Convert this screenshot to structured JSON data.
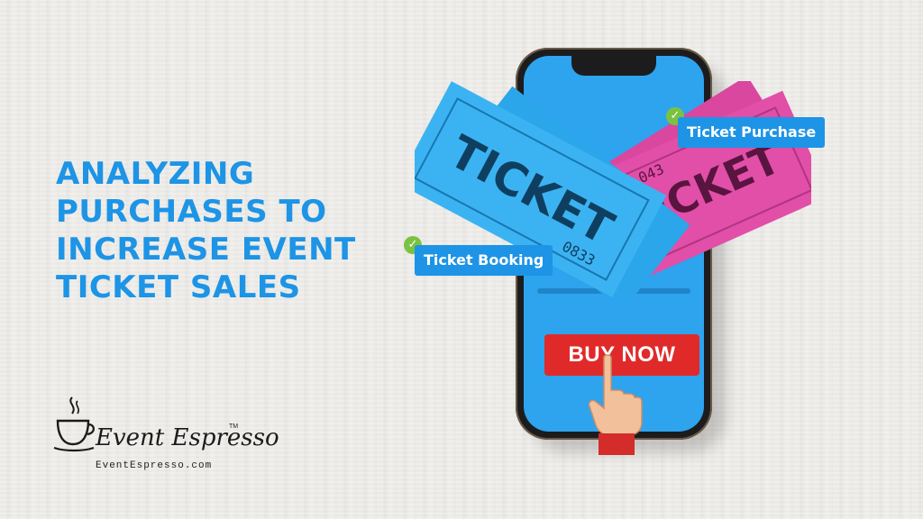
{
  "headline": {
    "line1": "ANALYZING",
    "line2": "PURCHASES TO",
    "line3": "INCREASE EVENT",
    "line4": "TICKET SALES"
  },
  "labels": {
    "booking": "Ticket Booking",
    "purchase": "Ticket Purchase"
  },
  "tickets": {
    "word": "TICKET",
    "number_blue": "0833",
    "number_pink": "043"
  },
  "buy_button": "BUY NOW",
  "logo": {
    "name": "Event Espresso",
    "trademark": "TM",
    "url": "EventEspresso.com"
  },
  "colors": {
    "accent_blue": "#1d94e6",
    "screen_blue": "#2ea3ee",
    "ticket_blue": "#3bb3f2",
    "ticket_pink": "#e14fa8",
    "buy_red": "#e02a2a",
    "check_green": "#7cc242"
  },
  "icons": [
    "check-icon",
    "pointing-hand-icon",
    "coffee-cup-icon"
  ]
}
